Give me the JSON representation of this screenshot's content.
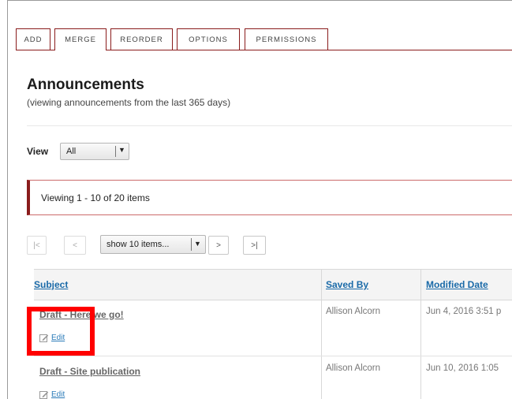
{
  "toolbar": {
    "buttons": [
      {
        "label": "ADD"
      },
      {
        "label": "MERGE"
      },
      {
        "label": "REORDER"
      },
      {
        "label": "OPTIONS"
      },
      {
        "label": "PERMISSIONS"
      }
    ]
  },
  "header": {
    "title": "Announcements",
    "subtitle": "(viewing announcements from the last 365 days)"
  },
  "view": {
    "label": "View",
    "selected": "All"
  },
  "info": {
    "text": "Viewing 1 - 10 of 20 items"
  },
  "pager": {
    "first": "|<",
    "prev": "<",
    "page_size": "show 10 items...",
    "next": ">",
    "last": ">|"
  },
  "table": {
    "columns": [
      "Subject",
      "Saved By",
      "Modified Date"
    ],
    "rows": [
      {
        "subject": "Draft - Here we go!",
        "edit": "Edit",
        "saved_by": "Allison Alcorn",
        "modified": "Jun 4, 2016 3:51 p"
      },
      {
        "subject": "Draft - Site publication",
        "edit": "Edit",
        "saved_by": "Allison Alcorn",
        "modified": "Jun 10, 2016 1:05"
      }
    ]
  },
  "colors": {
    "accent": "#8a1c1c",
    "link": "#1a6aa8",
    "highlight": "#ff0000"
  }
}
